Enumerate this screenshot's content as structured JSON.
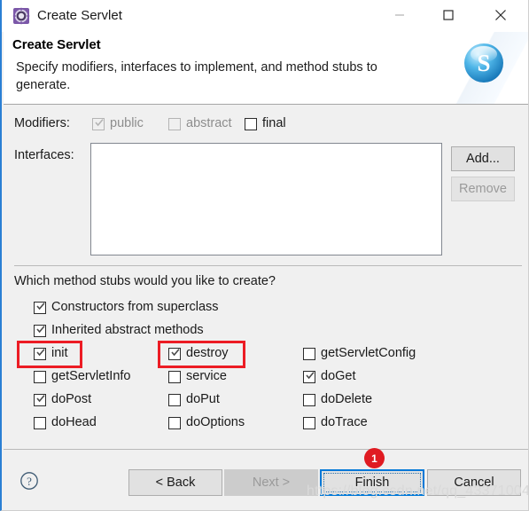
{
  "window": {
    "title": "Create Servlet",
    "icon": "servlet-gear-icon",
    "controls": {
      "minimize": "minimize-icon",
      "maximize": "maximize-icon",
      "close": "close-icon"
    }
  },
  "banner": {
    "title": "Create Servlet",
    "description": "Specify modifiers, interfaces to implement, and method stubs to generate.",
    "art_icon": "servlet-s-sphere-icon"
  },
  "modifiers": {
    "label": "Modifiers:",
    "items": [
      {
        "label": "public",
        "checked": true,
        "enabled": false
      },
      {
        "label": "abstract",
        "checked": false,
        "enabled": false
      },
      {
        "label": "final",
        "checked": false,
        "enabled": true
      }
    ]
  },
  "interfaces": {
    "label": "Interfaces:",
    "values": [],
    "add_label": "Add...",
    "remove_label": "Remove",
    "remove_enabled": false
  },
  "method_stubs": {
    "question": "Which method stubs would you like to create?",
    "full_width": [
      {
        "label": "Constructors from superclass",
        "checked": true
      },
      {
        "label": "Inherited abstract methods",
        "checked": true
      }
    ],
    "column1": [
      {
        "label": "init",
        "checked": true
      },
      {
        "label": "getServletInfo",
        "checked": false
      },
      {
        "label": "doPost",
        "checked": true
      },
      {
        "label": "doHead",
        "checked": false
      }
    ],
    "column2": [
      {
        "label": "destroy",
        "checked": true
      },
      {
        "label": "service",
        "checked": false
      },
      {
        "label": "doPut",
        "checked": false
      },
      {
        "label": "doOptions",
        "checked": false
      }
    ],
    "column3": [
      {
        "label": "getServletConfig",
        "checked": false
      },
      {
        "label": "doGet",
        "checked": true
      },
      {
        "label": "doDelete",
        "checked": false
      },
      {
        "label": "doTrace",
        "checked": false
      }
    ]
  },
  "buttonbar": {
    "help_icon": "help-question-icon",
    "back": "< Back",
    "next": "Next >",
    "next_enabled": false,
    "finish": "Finish",
    "finish_focused": true,
    "cancel": "Cancel"
  },
  "annotations": {
    "badge_label": "1",
    "badge_color": "#e01b22",
    "box_color": "#ec1c24",
    "watermark": "https://blog.csdn.net/qq_43371004"
  }
}
